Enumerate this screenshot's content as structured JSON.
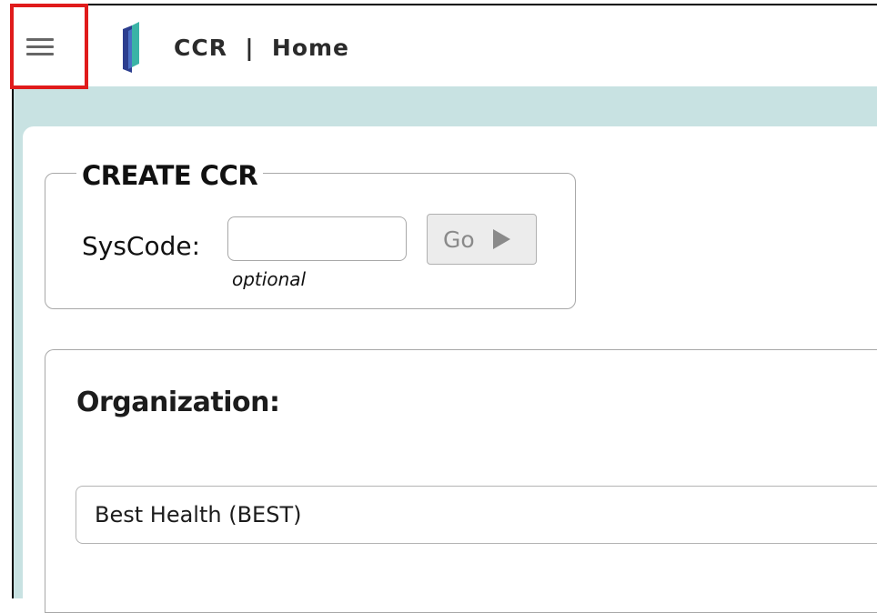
{
  "header": {
    "title": "CCR  |  Home",
    "menu_icon": "hamburger-menu-icon",
    "logo_icon": "app-logo-icon"
  },
  "create_ccr": {
    "legend": "CREATE CCR",
    "syscode_label": "SysCode:",
    "syscode_value": "",
    "syscode_hint": "optional",
    "go_label": "Go",
    "go_icon": "play-arrow-icon"
  },
  "organization": {
    "heading": "Organization:",
    "selected": "Best Health (BEST)"
  },
  "colors": {
    "band": "#c8e2e2",
    "highlight": "#e01b1b",
    "logo_teal": "#3bb3a6",
    "logo_navy": "#2c3e8f"
  }
}
